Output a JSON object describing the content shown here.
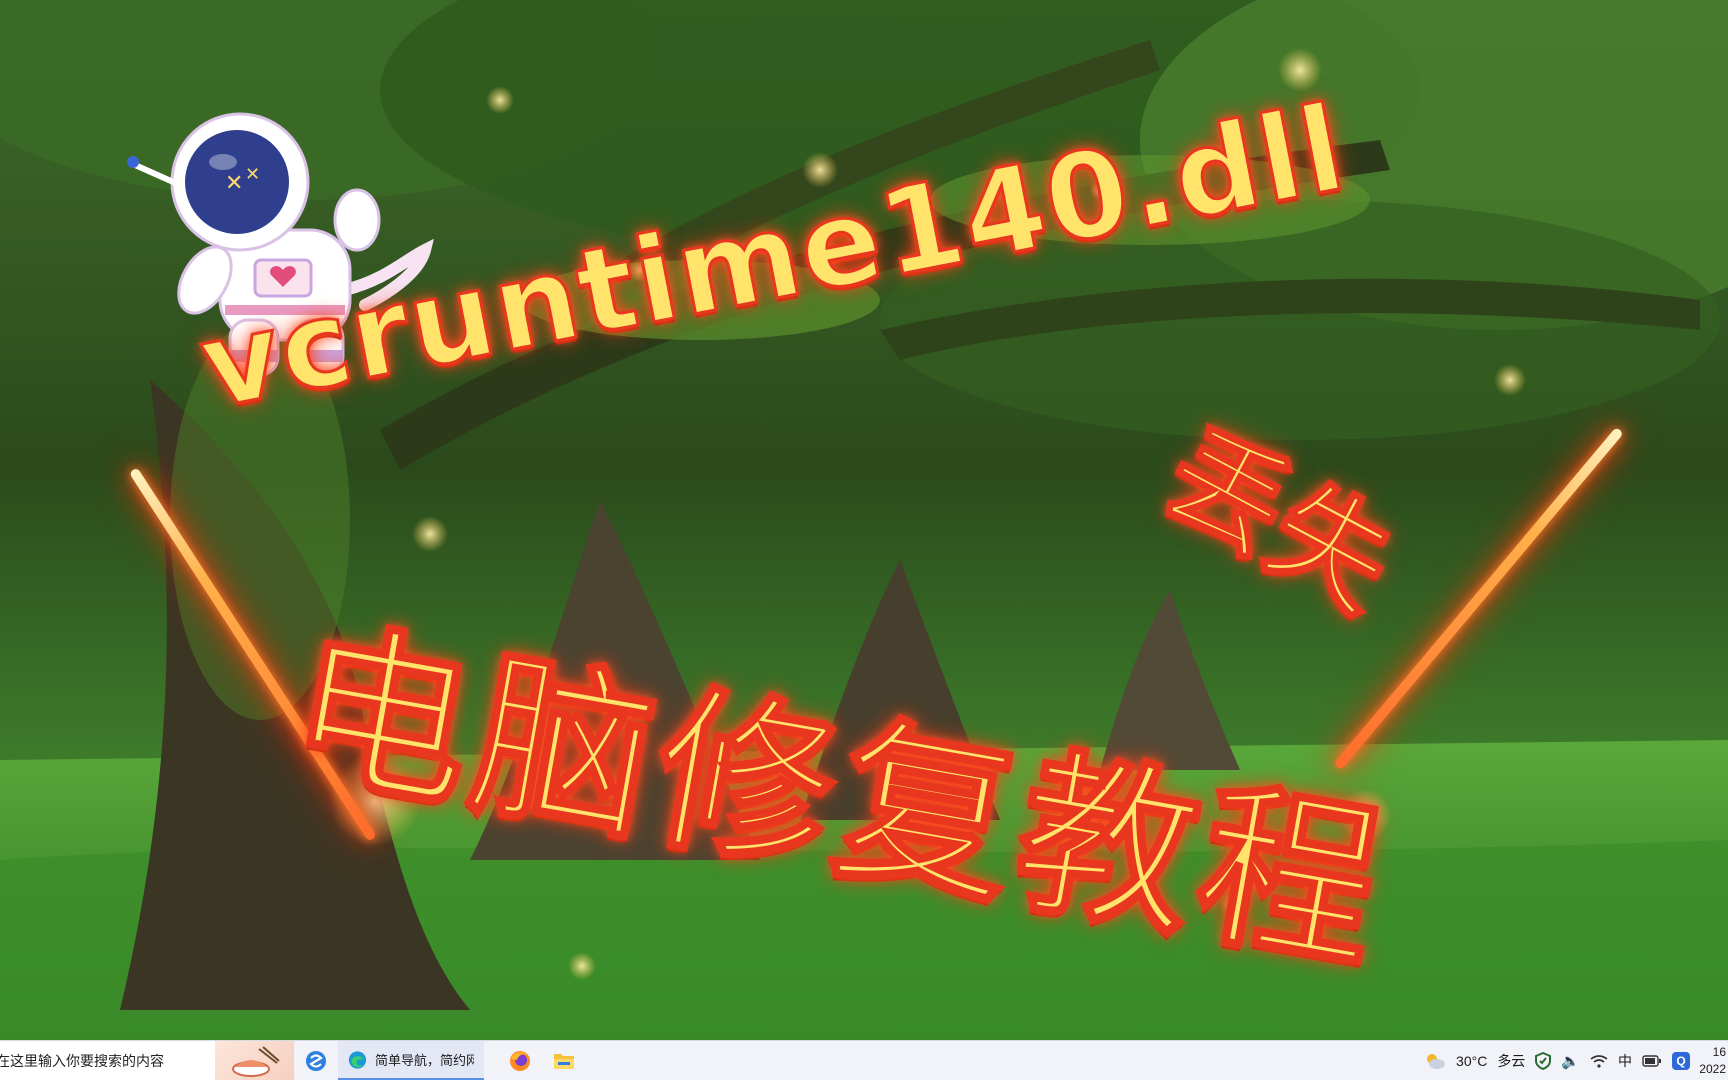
{
  "thumbnail": {
    "title_line1": "vcruntime140.dll",
    "title_line1_suffix": "丢失",
    "title_line2": "电脑修复教程",
    "colors": {
      "title_fill": "#ffe36a",
      "title_outline": "#e8361f",
      "saber_glow": "#ff5a1f"
    }
  },
  "taskbar": {
    "search": {
      "placeholder": "在这里输入你要搜索的内容",
      "icon": "promo-image-icon"
    },
    "pinned": [
      {
        "name": "sogou-browser-icon"
      },
      {
        "name": "edge-browser-icon",
        "label": "简单导航，简约网..."
      },
      {
        "name": "firefox-icon"
      },
      {
        "name": "file-explorer-icon"
      }
    ],
    "tray": {
      "weather_icon": "cloud-sun-icon",
      "temperature": "30°C",
      "weather_text": "多云",
      "security_icon": "shield-icon",
      "volume_icon": "speaker-icon",
      "network_icon": "wifi-icon",
      "ime": "中",
      "battery_icon": "battery-icon",
      "app_badge": "Q",
      "time": "16",
      "date": "2022"
    }
  }
}
